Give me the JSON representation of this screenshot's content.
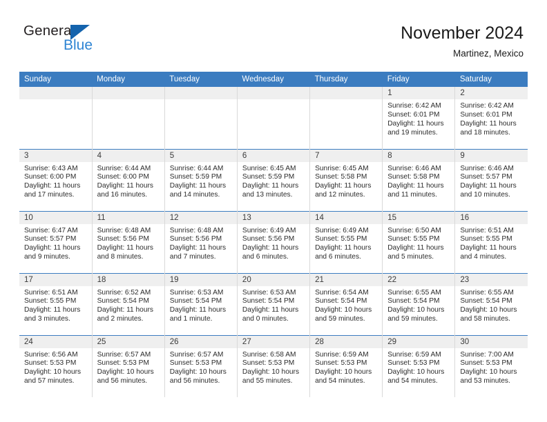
{
  "logo": {
    "word1": "General",
    "word2": "Blue",
    "triangle_icon": "blue-triangle-icon",
    "color_dark": "#231f20",
    "color_blue": "#2e84d3"
  },
  "header": {
    "title": "November 2024",
    "subtitle": "Martinez, Mexico",
    "accent_color": "#3b7cc0"
  },
  "weekday_headers": [
    "Sunday",
    "Monday",
    "Tuesday",
    "Wednesday",
    "Thursday",
    "Friday",
    "Saturday"
  ],
  "labels": {
    "sunrise": "Sunrise:",
    "sunset": "Sunset:",
    "daylight": "Daylight:"
  },
  "weeks": [
    [
      {
        "day": "",
        "empty": true
      },
      {
        "day": "",
        "empty": true
      },
      {
        "day": "",
        "empty": true
      },
      {
        "day": "",
        "empty": true
      },
      {
        "day": "",
        "empty": true
      },
      {
        "day": "1",
        "sunrise": "Sunrise: 6:42 AM",
        "sunset": "Sunset: 6:01 PM",
        "daylight": "Daylight: 11 hours and 19 minutes."
      },
      {
        "day": "2",
        "sunrise": "Sunrise: 6:42 AM",
        "sunset": "Sunset: 6:01 PM",
        "daylight": "Daylight: 11 hours and 18 minutes."
      }
    ],
    [
      {
        "day": "3",
        "sunrise": "Sunrise: 6:43 AM",
        "sunset": "Sunset: 6:00 PM",
        "daylight": "Daylight: 11 hours and 17 minutes."
      },
      {
        "day": "4",
        "sunrise": "Sunrise: 6:44 AM",
        "sunset": "Sunset: 6:00 PM",
        "daylight": "Daylight: 11 hours and 16 minutes."
      },
      {
        "day": "5",
        "sunrise": "Sunrise: 6:44 AM",
        "sunset": "Sunset: 5:59 PM",
        "daylight": "Daylight: 11 hours and 14 minutes."
      },
      {
        "day": "6",
        "sunrise": "Sunrise: 6:45 AM",
        "sunset": "Sunset: 5:59 PM",
        "daylight": "Daylight: 11 hours and 13 minutes."
      },
      {
        "day": "7",
        "sunrise": "Sunrise: 6:45 AM",
        "sunset": "Sunset: 5:58 PM",
        "daylight": "Daylight: 11 hours and 12 minutes."
      },
      {
        "day": "8",
        "sunrise": "Sunrise: 6:46 AM",
        "sunset": "Sunset: 5:58 PM",
        "daylight": "Daylight: 11 hours and 11 minutes."
      },
      {
        "day": "9",
        "sunrise": "Sunrise: 6:46 AM",
        "sunset": "Sunset: 5:57 PM",
        "daylight": "Daylight: 11 hours and 10 minutes."
      }
    ],
    [
      {
        "day": "10",
        "sunrise": "Sunrise: 6:47 AM",
        "sunset": "Sunset: 5:57 PM",
        "daylight": "Daylight: 11 hours and 9 minutes."
      },
      {
        "day": "11",
        "sunrise": "Sunrise: 6:48 AM",
        "sunset": "Sunset: 5:56 PM",
        "daylight": "Daylight: 11 hours and 8 minutes."
      },
      {
        "day": "12",
        "sunrise": "Sunrise: 6:48 AM",
        "sunset": "Sunset: 5:56 PM",
        "daylight": "Daylight: 11 hours and 7 minutes."
      },
      {
        "day": "13",
        "sunrise": "Sunrise: 6:49 AM",
        "sunset": "Sunset: 5:56 PM",
        "daylight": "Daylight: 11 hours and 6 minutes."
      },
      {
        "day": "14",
        "sunrise": "Sunrise: 6:49 AM",
        "sunset": "Sunset: 5:55 PM",
        "daylight": "Daylight: 11 hours and 6 minutes."
      },
      {
        "day": "15",
        "sunrise": "Sunrise: 6:50 AM",
        "sunset": "Sunset: 5:55 PM",
        "daylight": "Daylight: 11 hours and 5 minutes."
      },
      {
        "day": "16",
        "sunrise": "Sunrise: 6:51 AM",
        "sunset": "Sunset: 5:55 PM",
        "daylight": "Daylight: 11 hours and 4 minutes."
      }
    ],
    [
      {
        "day": "17",
        "sunrise": "Sunrise: 6:51 AM",
        "sunset": "Sunset: 5:55 PM",
        "daylight": "Daylight: 11 hours and 3 minutes."
      },
      {
        "day": "18",
        "sunrise": "Sunrise: 6:52 AM",
        "sunset": "Sunset: 5:54 PM",
        "daylight": "Daylight: 11 hours and 2 minutes."
      },
      {
        "day": "19",
        "sunrise": "Sunrise: 6:53 AM",
        "sunset": "Sunset: 5:54 PM",
        "daylight": "Daylight: 11 hours and 1 minute."
      },
      {
        "day": "20",
        "sunrise": "Sunrise: 6:53 AM",
        "sunset": "Sunset: 5:54 PM",
        "daylight": "Daylight: 11 hours and 0 minutes."
      },
      {
        "day": "21",
        "sunrise": "Sunrise: 6:54 AM",
        "sunset": "Sunset: 5:54 PM",
        "daylight": "Daylight: 10 hours and 59 minutes."
      },
      {
        "day": "22",
        "sunrise": "Sunrise: 6:55 AM",
        "sunset": "Sunset: 5:54 PM",
        "daylight": "Daylight: 10 hours and 59 minutes."
      },
      {
        "day": "23",
        "sunrise": "Sunrise: 6:55 AM",
        "sunset": "Sunset: 5:54 PM",
        "daylight": "Daylight: 10 hours and 58 minutes."
      }
    ],
    [
      {
        "day": "24",
        "sunrise": "Sunrise: 6:56 AM",
        "sunset": "Sunset: 5:53 PM",
        "daylight": "Daylight: 10 hours and 57 minutes."
      },
      {
        "day": "25",
        "sunrise": "Sunrise: 6:57 AM",
        "sunset": "Sunset: 5:53 PM",
        "daylight": "Daylight: 10 hours and 56 minutes."
      },
      {
        "day": "26",
        "sunrise": "Sunrise: 6:57 AM",
        "sunset": "Sunset: 5:53 PM",
        "daylight": "Daylight: 10 hours and 56 minutes."
      },
      {
        "day": "27",
        "sunrise": "Sunrise: 6:58 AM",
        "sunset": "Sunset: 5:53 PM",
        "daylight": "Daylight: 10 hours and 55 minutes."
      },
      {
        "day": "28",
        "sunrise": "Sunrise: 6:59 AM",
        "sunset": "Sunset: 5:53 PM",
        "daylight": "Daylight: 10 hours and 54 minutes."
      },
      {
        "day": "29",
        "sunrise": "Sunrise: 6:59 AM",
        "sunset": "Sunset: 5:53 PM",
        "daylight": "Daylight: 10 hours and 54 minutes."
      },
      {
        "day": "30",
        "sunrise": "Sunrise: 7:00 AM",
        "sunset": "Sunset: 5:53 PM",
        "daylight": "Daylight: 10 hours and 53 minutes."
      }
    ]
  ]
}
